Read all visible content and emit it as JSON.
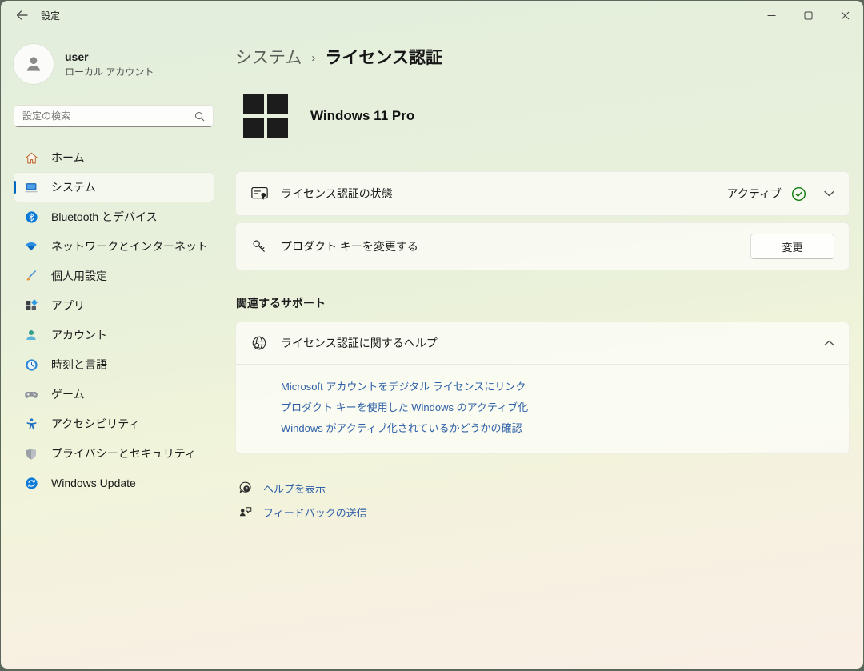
{
  "window": {
    "title": "設定",
    "controls": {
      "minimize": "minimize",
      "maximize": "maximize",
      "close": "close"
    }
  },
  "sidebar": {
    "user": {
      "name": "user",
      "account_type": "ローカル アカウント"
    },
    "search": {
      "placeholder": "設定の検索"
    },
    "items": [
      {
        "label": "ホーム",
        "icon": "home-icon",
        "selected": false
      },
      {
        "label": "システム",
        "icon": "system-icon",
        "selected": true
      },
      {
        "label": "Bluetooth とデバイス",
        "icon": "bluetooth-icon",
        "selected": false
      },
      {
        "label": "ネットワークとインターネット",
        "icon": "network-icon",
        "selected": false
      },
      {
        "label": "個人用設定",
        "icon": "personalization-icon",
        "selected": false
      },
      {
        "label": "アプリ",
        "icon": "apps-icon",
        "selected": false
      },
      {
        "label": "アカウント",
        "icon": "accounts-icon",
        "selected": false
      },
      {
        "label": "時刻と言語",
        "icon": "time-language-icon",
        "selected": false
      },
      {
        "label": "ゲーム",
        "icon": "gaming-icon",
        "selected": false
      },
      {
        "label": "アクセシビリティ",
        "icon": "accessibility-icon",
        "selected": false
      },
      {
        "label": "プライバシーとセキュリティ",
        "icon": "privacy-icon",
        "selected": false
      },
      {
        "label": "Windows Update",
        "icon": "windows-update-icon",
        "selected": false
      }
    ]
  },
  "main": {
    "breadcrumb": {
      "parent": "システム",
      "separator": "›",
      "current": "ライセンス認証"
    },
    "edition": "Windows 11 Pro",
    "activation_card": {
      "label": "ライセンス認証の状態",
      "status": "アクティブ"
    },
    "product_key_card": {
      "label": "プロダクト キーを変更する",
      "button": "変更"
    },
    "related_support": {
      "heading": "関連するサポート",
      "help_card": {
        "title": "ライセンス認証に関するヘルプ",
        "links": [
          "Microsoft アカウントをデジタル ライセンスにリンク",
          "プロダクト キーを使用した Windows のアクティブ化",
          "Windows がアクティブ化されているかどうかの確認"
        ]
      }
    },
    "footer_links": [
      {
        "label": "ヘルプを表示",
        "icon": "get-help-icon"
      },
      {
        "label": "フィードバックの送信",
        "icon": "feedback-icon"
      }
    ]
  },
  "colors": {
    "accent": "#0067c0",
    "status_ok": "#0f7b0f",
    "link": "#3061a8",
    "bg_top": "#e3eedd",
    "bg_bottom": "#f9efe4"
  }
}
